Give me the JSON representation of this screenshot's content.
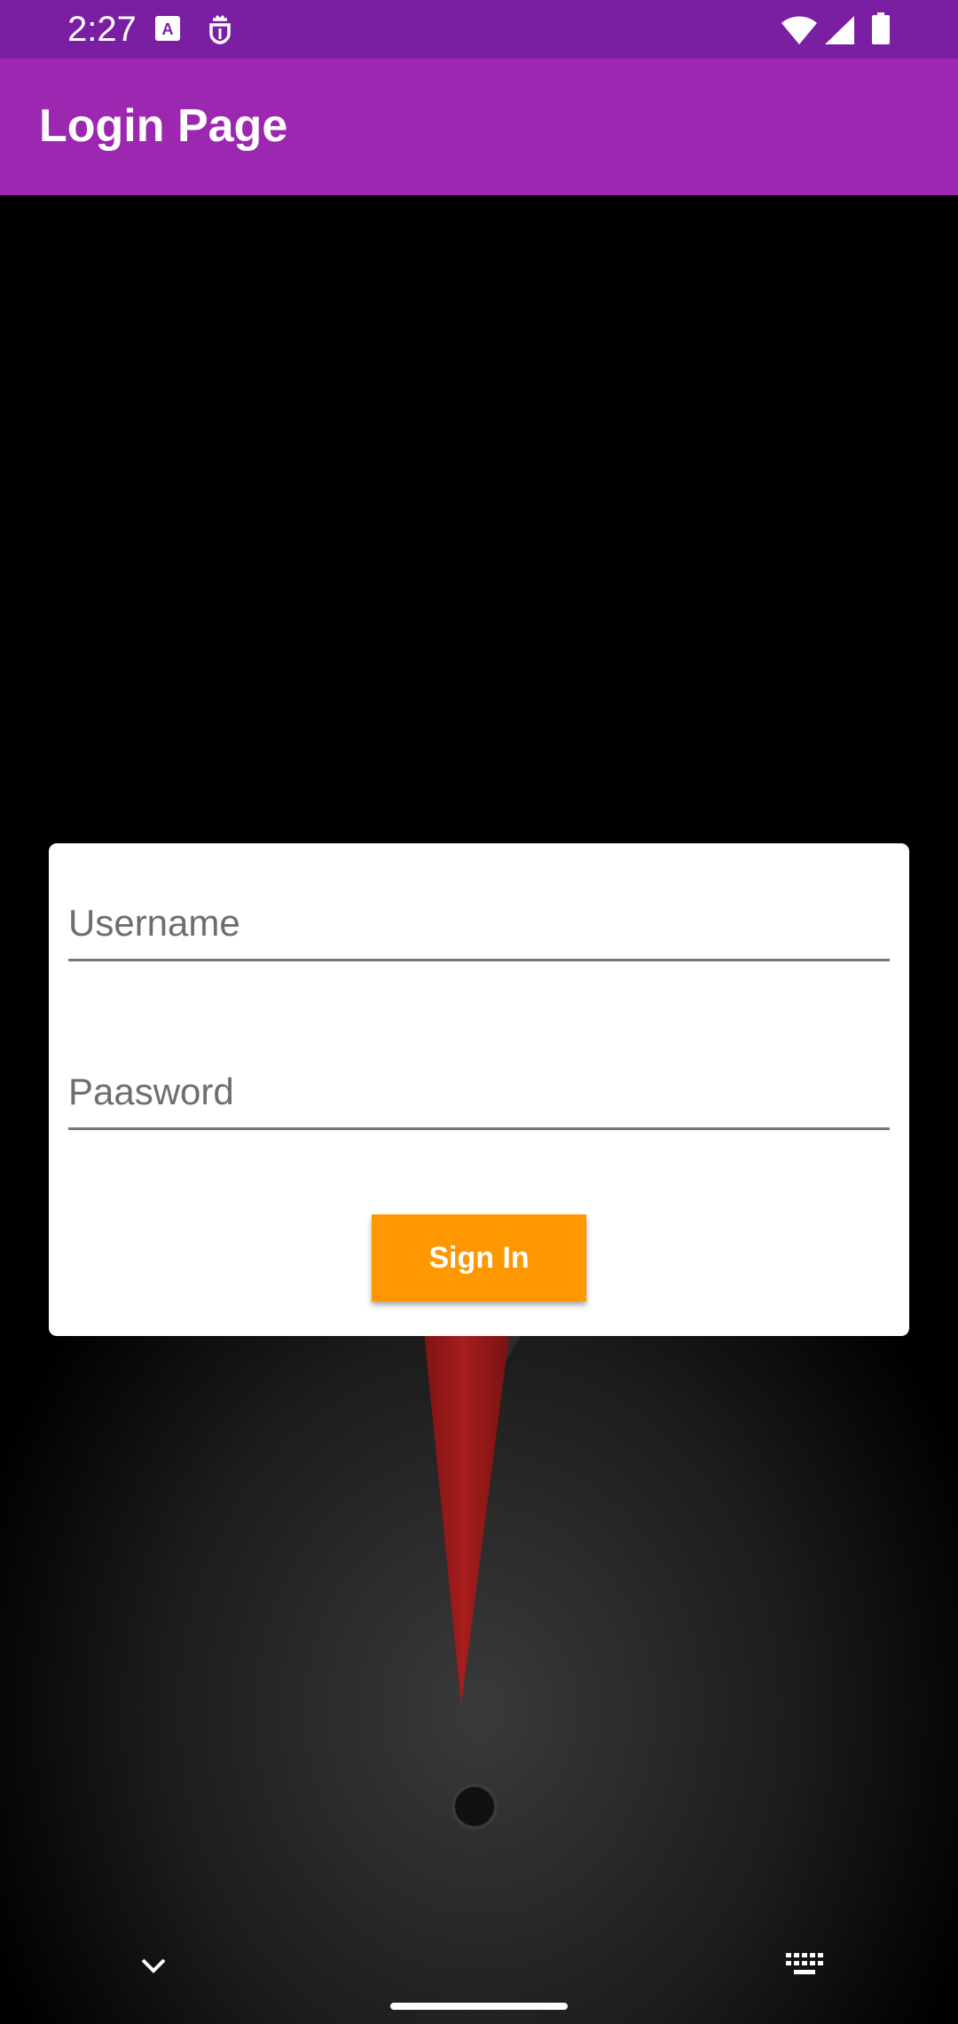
{
  "status_bar": {
    "time": "2:27",
    "icons": [
      "text-recognition-icon",
      "shield-bug-icon",
      "wifi-icon",
      "cellular-signal-icon",
      "battery-icon"
    ]
  },
  "app_bar": {
    "title": "Login Page"
  },
  "login_form": {
    "username": {
      "placeholder": "Username",
      "value": ""
    },
    "password": {
      "placeholder": "Paasword",
      "value": ""
    },
    "submit_label": "Sign In"
  },
  "navigation_bar": {
    "icons": [
      "chevron-down-icon",
      "keyboard-icon"
    ]
  },
  "colors": {
    "status_bar": "#7B1FA2",
    "app_bar": "#9C27B0",
    "button": "#FF9800",
    "card": "#FFFFFF",
    "background": "#000000"
  }
}
